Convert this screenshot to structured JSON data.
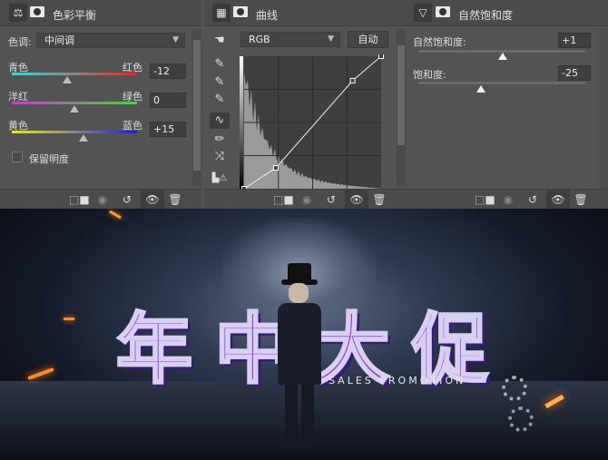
{
  "color_balance": {
    "title": "色彩平衡",
    "tone_label": "色调:",
    "tone_value": "中间调",
    "sliders": [
      {
        "left": "青色",
        "right": "红色",
        "value": "-12",
        "from": "#22e0e0",
        "to": "#ee2222",
        "pos": -12
      },
      {
        "left": "洋红",
        "right": "绿色",
        "value": "0",
        "from": "#ee22ee",
        "to": "#22ee22",
        "pos": 0
      },
      {
        "left": "黄色",
        "right": "蓝色",
        "value": "+15",
        "from": "#eeee00",
        "to": "#1a1aee",
        "pos": 15
      }
    ],
    "preserve_luminosity": "保留明度"
  },
  "curves": {
    "title": "曲线",
    "channel": "RGB",
    "auto_label": "自动",
    "points": [
      [
        0,
        0
      ],
      [
        59,
        40
      ],
      [
        202,
        208
      ],
      [
        255,
        255
      ]
    ]
  },
  "vibrance": {
    "title": "自然饱和度",
    "vibrance_label": "自然饱和度:",
    "vibrance_value": "+1",
    "vibrance_pos": 1,
    "saturation_label": "饱和度:",
    "saturation_value": "-25",
    "saturation_pos": -25
  },
  "poster": {
    "title_chars": [
      "年",
      "中",
      "大",
      "促"
    ],
    "subtitle": "SALES PROMOTION"
  }
}
